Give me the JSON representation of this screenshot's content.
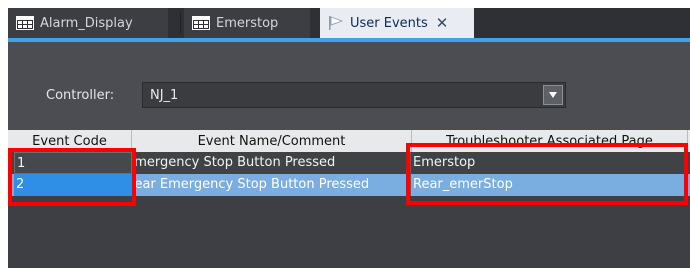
{
  "tabs": [
    {
      "label": "Alarm_Display",
      "icon": "grid-icon",
      "state": "inactive"
    },
    {
      "label": "Emerstop",
      "icon": "grid-icon",
      "state": "inactive"
    },
    {
      "label": "User Events",
      "icon": "flag-icon",
      "state": "active",
      "close": "✕"
    }
  ],
  "controller": {
    "label": "Controller:",
    "value": "NJ_1"
  },
  "table": {
    "columns": [
      "Event Code",
      "Event Name/Comment",
      "Troubleshooter Associated Page"
    ],
    "rows": [
      {
        "code": "1",
        "name": "Emergency Stop Button Pressed",
        "page": "Emerstop",
        "selected": false
      },
      {
        "code": "2",
        "name": "Rear Emergency Stop Button Pressed",
        "page": "Rear_emerStop",
        "selected": true
      }
    ]
  },
  "colors": {
    "accent": "#3ea3ea",
    "highlight": "#ff0000",
    "selected_row": "#7aaee0",
    "background": "#4b4d52"
  }
}
